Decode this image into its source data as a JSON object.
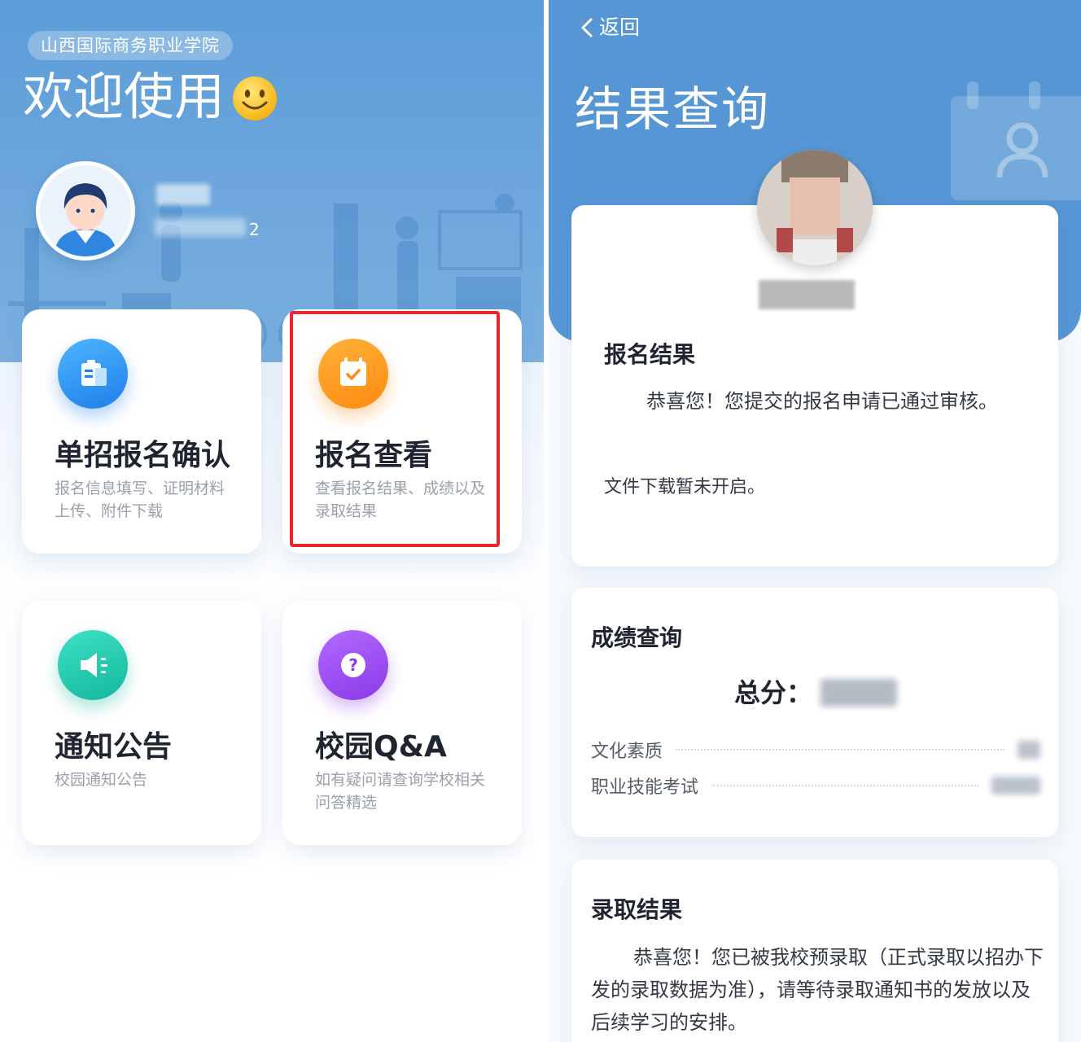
{
  "left": {
    "school_name": "山西国际商务职业学院",
    "welcome": "欢迎使用",
    "user_id_suffix": "2",
    "cards": [
      {
        "title": "单招报名确认",
        "desc": "报名信息填写、证明材料上传、附件下载",
        "icon": "clipboard-icon",
        "color": "#1e7fe8"
      },
      {
        "title": "报名查看",
        "desc": "查看报名结果、成绩以及录取结果",
        "icon": "calendar-check-icon",
        "color": "#ff8a10"
      },
      {
        "title": "通知公告",
        "desc": "校园通知公告",
        "icon": "speaker-icon",
        "color": "#14b89c"
      },
      {
        "title": "校园Q&A",
        "desc": "如有疑问请查询学校相关问答精选",
        "icon": "question-icon",
        "color": "#8a3ae8"
      }
    ],
    "highlight_color": "#e8262b"
  },
  "right": {
    "back_label": "返回",
    "title": "结果查询",
    "registration": {
      "title": "报名结果",
      "message": "恭喜您！您提交的报名申请已通过审核。",
      "download_note": "文件下载暂未开启。"
    },
    "score": {
      "title": "成绩查询",
      "total_label": "总分：",
      "items": [
        {
          "label": "文化素质"
        },
        {
          "label": "职业技能考试"
        }
      ]
    },
    "admission": {
      "title": "录取结果",
      "message": "恭喜您！您已被我校预录取（正式录取以招办下发的录取数据为准），请等待录取通知书的发放以及后续学习的安排。"
    },
    "accent": "#5696d4"
  }
}
